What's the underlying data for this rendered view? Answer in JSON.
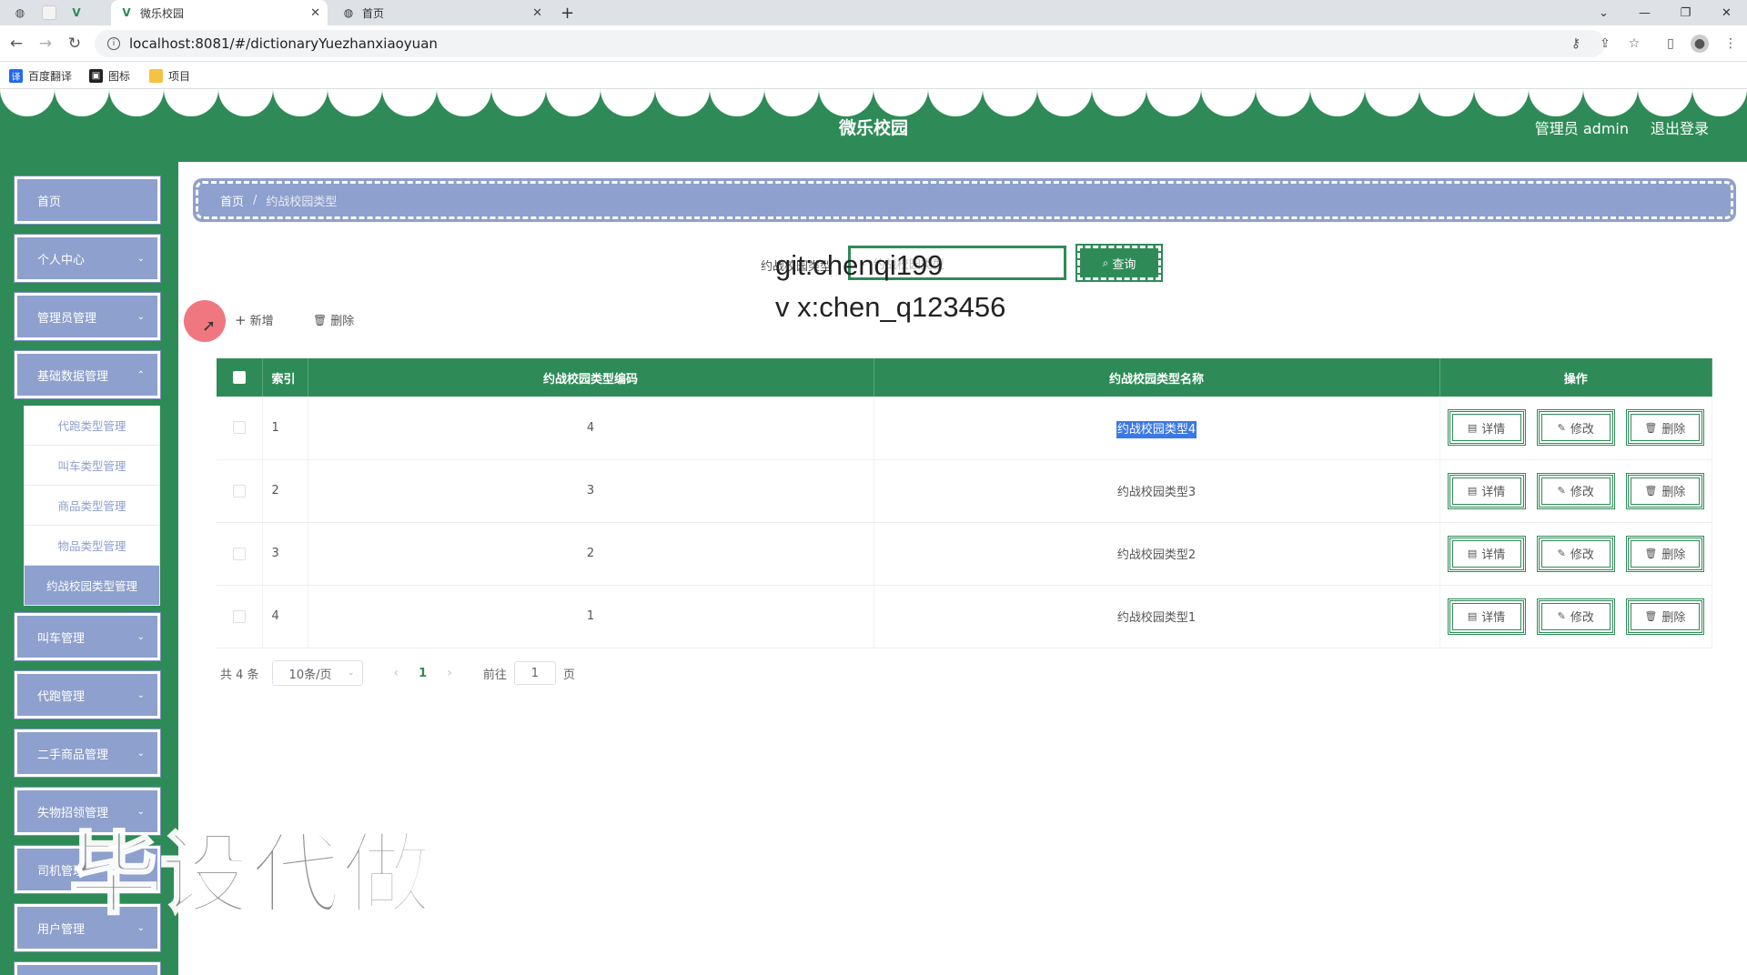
{
  "browser": {
    "tabs": [
      {
        "title": "微乐校园",
        "active": true
      },
      {
        "title": "首页",
        "active": false
      }
    ],
    "new_tab": "+",
    "url": "localhost:8081/#/dictionaryYuezhanxiaoyuan",
    "bookmarks": [
      {
        "label": "百度翻译",
        "color": "#2468f2",
        "glyph": "译"
      },
      {
        "label": "图标",
        "color": "#222222",
        "glyph": "▣"
      },
      {
        "label": "项目",
        "color": "#f5c242",
        "glyph": ""
      }
    ]
  },
  "header": {
    "title": "微乐校园",
    "user": "管理员 admin",
    "logout": "退出登录"
  },
  "sidebar": {
    "items": [
      {
        "label": "首页",
        "has_children": false
      },
      {
        "label": "个人中心",
        "has_children": true
      },
      {
        "label": "管理员管理",
        "has_children": true
      },
      {
        "label": "基础数据管理",
        "has_children": true
      },
      {
        "label": "叫车管理",
        "has_children": true
      },
      {
        "label": "代跑管理",
        "has_children": true
      },
      {
        "label": "二手商品管理",
        "has_children": true
      },
      {
        "label": "失物招领管理",
        "has_children": true
      },
      {
        "label": "司机管理",
        "has_children": true
      },
      {
        "label": "用户管理",
        "has_children": true
      }
    ],
    "submenu": [
      {
        "label": "代跑类型管理",
        "active": false
      },
      {
        "label": "叫车类型管理",
        "active": false
      },
      {
        "label": "商品类型管理",
        "active": false
      },
      {
        "label": "物品类型管理",
        "active": false
      },
      {
        "label": "约战校园类型管理",
        "active": true
      }
    ]
  },
  "breadcrumb": {
    "home": "首页",
    "separator": "/",
    "current": "约战校园类型"
  },
  "search": {
    "label": "约战校园类型",
    "placeholder": "约战校园类型",
    "button": "查询"
  },
  "toolbar": {
    "add": "新增",
    "delete": "删除"
  },
  "table": {
    "headers": [
      "索引",
      "约战校园类型编码",
      "约战校园类型名称",
      "操作"
    ],
    "rows": [
      {
        "index": "1",
        "code": "4",
        "name": "约战校园类型4",
        "selected_text": true
      },
      {
        "index": "2",
        "code": "3",
        "name": "约战校园类型3",
        "selected_text": false
      },
      {
        "index": "3",
        "code": "2",
        "name": "约战校园类型2",
        "selected_text": false
      },
      {
        "index": "4",
        "code": "1",
        "name": "约战校园类型1",
        "selected_text": false
      }
    ],
    "actions": [
      "详情",
      "修改",
      "删除"
    ]
  },
  "pagination": {
    "total": "共 4 条",
    "page_size": "10条/页",
    "current_page": "1",
    "goto_label": "前往",
    "goto_value": "1",
    "page_suffix": "页"
  },
  "overlays": {
    "git": "git:chenqi199",
    "vx": "v x:chen_q123456",
    "big": "毕设代做"
  },
  "colors": {
    "primary": "#2e8b57",
    "menu": "#8ea0cd",
    "selection": "#3b78e7"
  }
}
